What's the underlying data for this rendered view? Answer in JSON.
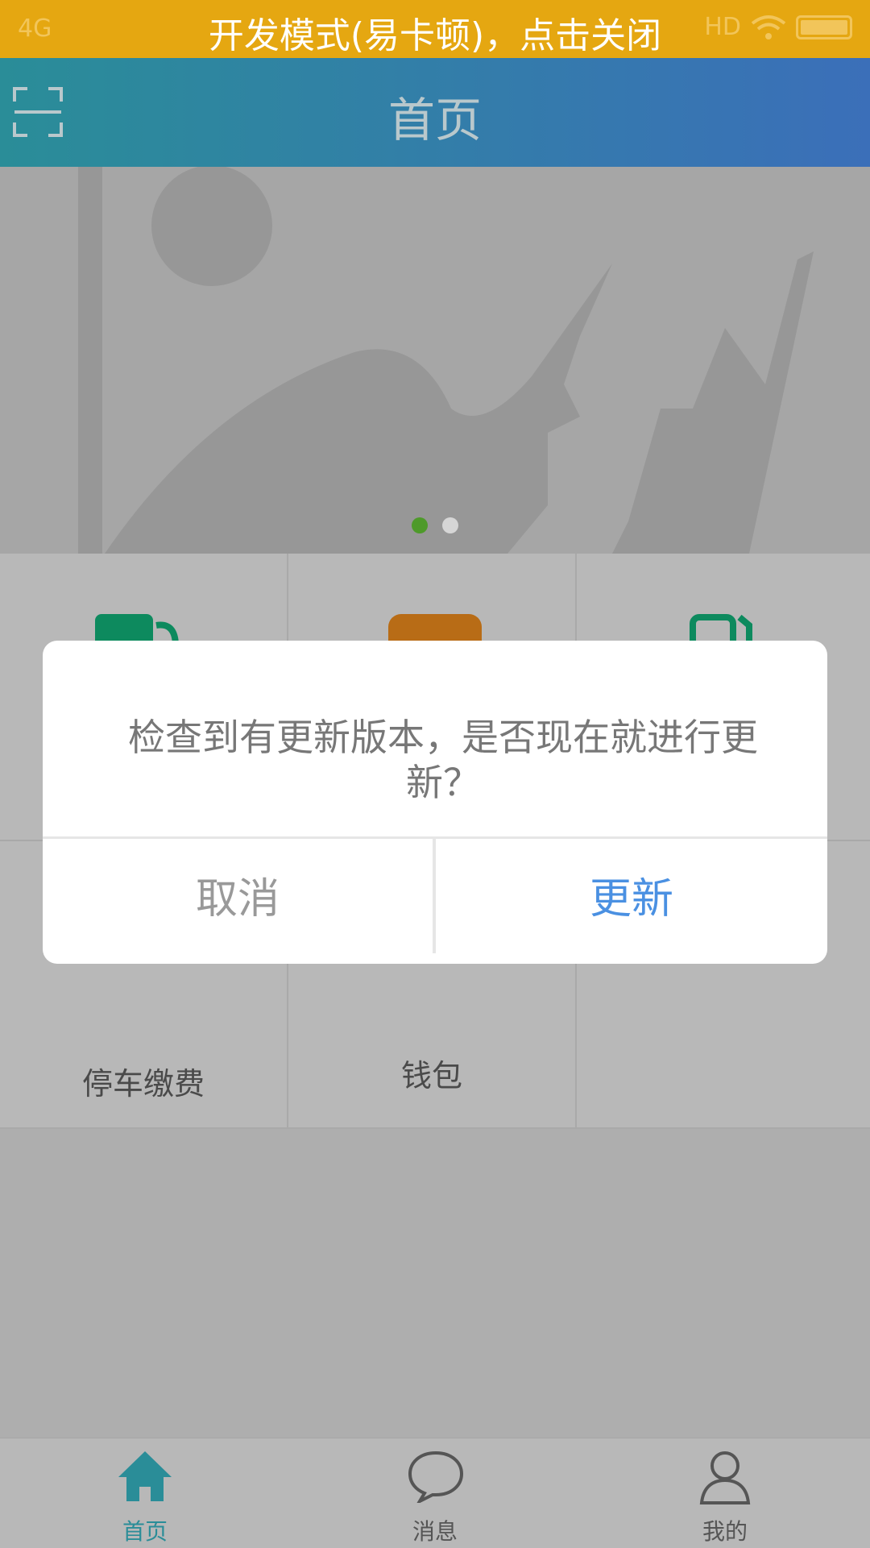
{
  "status_bar": {
    "network": "4G",
    "dev_mode_notice": "开发模式(易卡顿)，点击关闭",
    "hd": "HD"
  },
  "header": {
    "title": "首页"
  },
  "banner": {
    "page_count": 2,
    "active_page": 1,
    "active_dot_color": "#4e9a2a",
    "inactive_dot_color": "#d6d6d6"
  },
  "grid": {
    "items": [
      {
        "label": "",
        "icon": "fuel-station-icon",
        "color": "#0d8a5e"
      },
      {
        "label": "",
        "icon": "card-icon",
        "color": "#b86c16"
      },
      {
        "label": "",
        "icon": "charging-station-icon",
        "color": "#0d8a5e"
      },
      {
        "label": "停车缴费",
        "icon": "parking-pin-icon",
        "color": "#1a86b5"
      },
      {
        "label": "钱包",
        "icon": "wallet-icon",
        "color": "#1a86b5"
      },
      {
        "label": "",
        "icon": "",
        "color": ""
      }
    ]
  },
  "dialog": {
    "message": "检查到有更新版本，是否现在就进行更新？",
    "cancel_label": "取消",
    "update_label": "更新",
    "update_color": "#4a90e2"
  },
  "bottom_nav": {
    "items": [
      {
        "label": "首页",
        "icon": "home-icon",
        "active": true
      },
      {
        "label": "消息",
        "icon": "message-icon",
        "active": false
      },
      {
        "label": "我的",
        "icon": "user-icon",
        "active": false
      }
    ],
    "active_color": "#2a8d98"
  }
}
